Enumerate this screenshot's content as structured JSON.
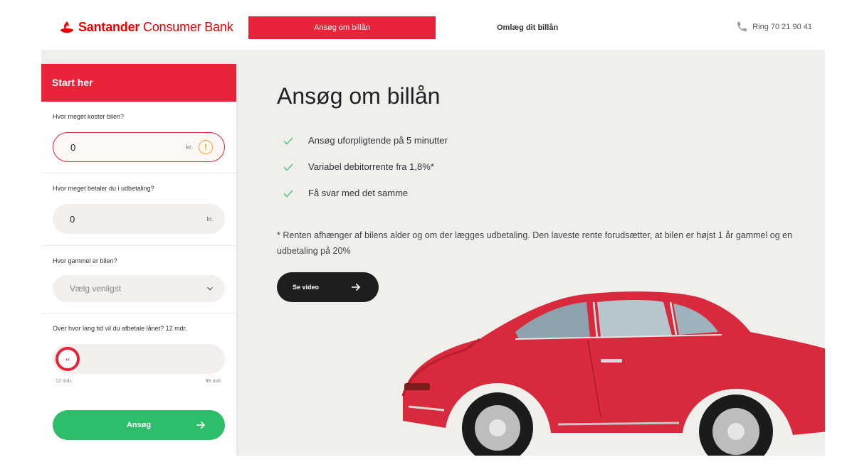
{
  "header": {
    "brand_bold": "Santander",
    "brand_rest": " Consumer Bank",
    "nav_primary": "Ansøg om billån",
    "nav_secondary": "Omlæg dit billån",
    "phone": "Ring 70 21 90 41",
    "phone_icon": "phone-icon"
  },
  "form": {
    "title": "Start her",
    "car_price": {
      "question": "Hvor meget koster bilen?",
      "value": "0",
      "unit": "kr.",
      "state": "error"
    },
    "down_payment": {
      "question": "Hvor meget betaler du i udbetaling?",
      "value": "0",
      "unit": "kr."
    },
    "car_age": {
      "question": "Hvor gammel er bilen?",
      "selected": "Vælg venligst"
    },
    "term": {
      "question": "Over hvor lang tid vil du afbetale lånet? 12 mdr.",
      "min_label": "12 mdr.",
      "max_label": "96 mdr.",
      "level": 0
    },
    "submit_label": "Ansøg"
  },
  "main": {
    "title": "Ansøg om billån",
    "benefits": [
      "Ansøg uforpligtende på 5 minutter",
      "Variabel debitorrente fra 1,8%*",
      "Få svar med det samme"
    ],
    "disclaimer": "* Renten afhænger af bilens alder og om der lægges udbetaling. Den laveste rente forudsætter, at bilen er højst 1 år gammel og en udbetaling på 20%",
    "video_label": "Se video"
  },
  "colors": {
    "brand_red": "#e8233a",
    "accent_green": "#2ebd6b",
    "check_green": "#5cc47e",
    "dark_button": "#1e1e1e",
    "warning": "#f5a623"
  }
}
